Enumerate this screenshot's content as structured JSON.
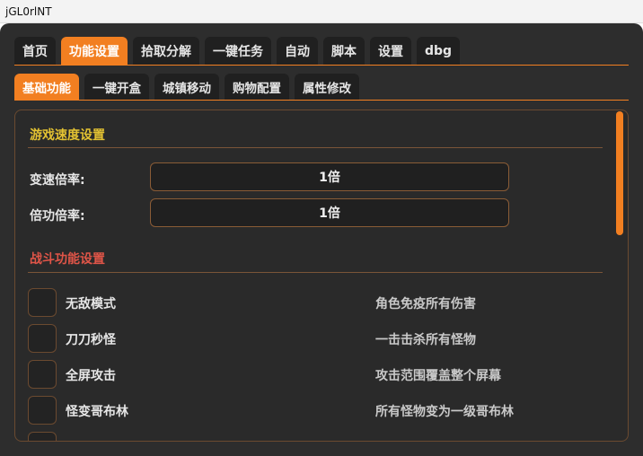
{
  "window": {
    "title": "jGL0rlNT"
  },
  "tabs_main": [
    {
      "label": "首页"
    },
    {
      "label": "功能设置"
    },
    {
      "label": "拾取分解"
    },
    {
      "label": "一键任务"
    },
    {
      "label": "自动"
    },
    {
      "label": "脚本"
    },
    {
      "label": "设置"
    },
    {
      "label": "dbg"
    }
  ],
  "tabs_main_active": "功能设置",
  "tabs_sub": [
    {
      "label": "基础功能"
    },
    {
      "label": "一键开盒"
    },
    {
      "label": "城镇移动"
    },
    {
      "label": "购物配置"
    },
    {
      "label": "属性修改"
    }
  ],
  "tabs_sub_active": "基础功能",
  "speed_section": {
    "title": "游戏速度设置",
    "fields": [
      {
        "label": "变速倍率:",
        "value": "1倍"
      },
      {
        "label": "倍功倍率:",
        "value": "1倍"
      }
    ]
  },
  "combat_section": {
    "title": "战斗功能设置",
    "rows": [
      {
        "label": "无敌模式",
        "desc": "角色免疫所有伤害",
        "checked": false
      },
      {
        "label": "刀刀秒怪",
        "desc": "一击击杀所有怪物",
        "checked": false
      },
      {
        "label": "全屏攻击",
        "desc": "攻击范围覆盖整个屏幕",
        "checked": false
      },
      {
        "label": "怪变哥布林",
        "desc": "所有怪物变为一级哥布林",
        "checked": false
      }
    ]
  },
  "colors": {
    "accent": "#f27f21",
    "background": "#2d2d2d",
    "section_speed_title": "#e3c232",
    "section_combat_title": "#e05548"
  }
}
